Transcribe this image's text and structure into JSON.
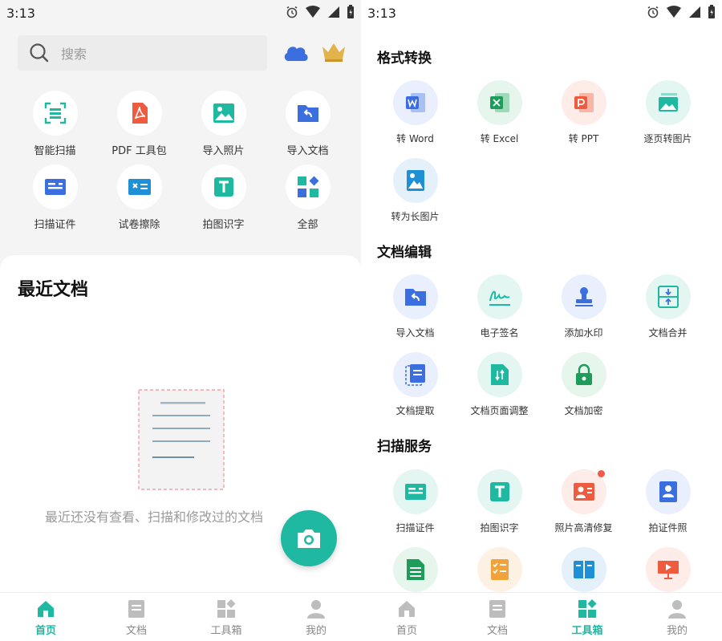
{
  "status": {
    "time": "3:13"
  },
  "left": {
    "search": {
      "placeholder": "搜索"
    },
    "tools": [
      {
        "label": "智能扫描"
      },
      {
        "label": "PDF 工具包"
      },
      {
        "label": "导入照片"
      },
      {
        "label": "导入文档"
      },
      {
        "label": "扫描证件"
      },
      {
        "label": "试卷擦除"
      },
      {
        "label": "拍图识字"
      },
      {
        "label": "全部"
      }
    ],
    "recent_title": "最近文档",
    "empty_text": "最近还没有查看、扫描和修改过的文档"
  },
  "right": {
    "sections": [
      {
        "title": "格式转换",
        "items": [
          {
            "label": "转 Word"
          },
          {
            "label": "转 Excel"
          },
          {
            "label": "转 PPT"
          },
          {
            "label": "逐页转图片"
          },
          {
            "label": "转为长图片"
          }
        ]
      },
      {
        "title": "文档编辑",
        "items": [
          {
            "label": "导入文档"
          },
          {
            "label": "电子签名"
          },
          {
            "label": "添加水印"
          },
          {
            "label": "文档合并"
          },
          {
            "label": "文档提取"
          },
          {
            "label": "文档页面调整"
          },
          {
            "label": "文档加密"
          }
        ]
      },
      {
        "title": "扫描服务",
        "items": [
          {
            "label": "扫描证件"
          },
          {
            "label": "拍图识字"
          },
          {
            "label": "照片高清修复"
          },
          {
            "label": "拍证件照"
          }
        ]
      }
    ]
  },
  "nav": [
    {
      "label": "首页"
    },
    {
      "label": "文档"
    },
    {
      "label": "工具箱"
    },
    {
      "label": "我的"
    }
  ],
  "colors": {
    "accent": "#1fb8a1",
    "badge": "#f15a4a",
    "word": "#3b6fe0",
    "excel": "#1e9c5a",
    "ppt": "#ef5b3f"
  }
}
